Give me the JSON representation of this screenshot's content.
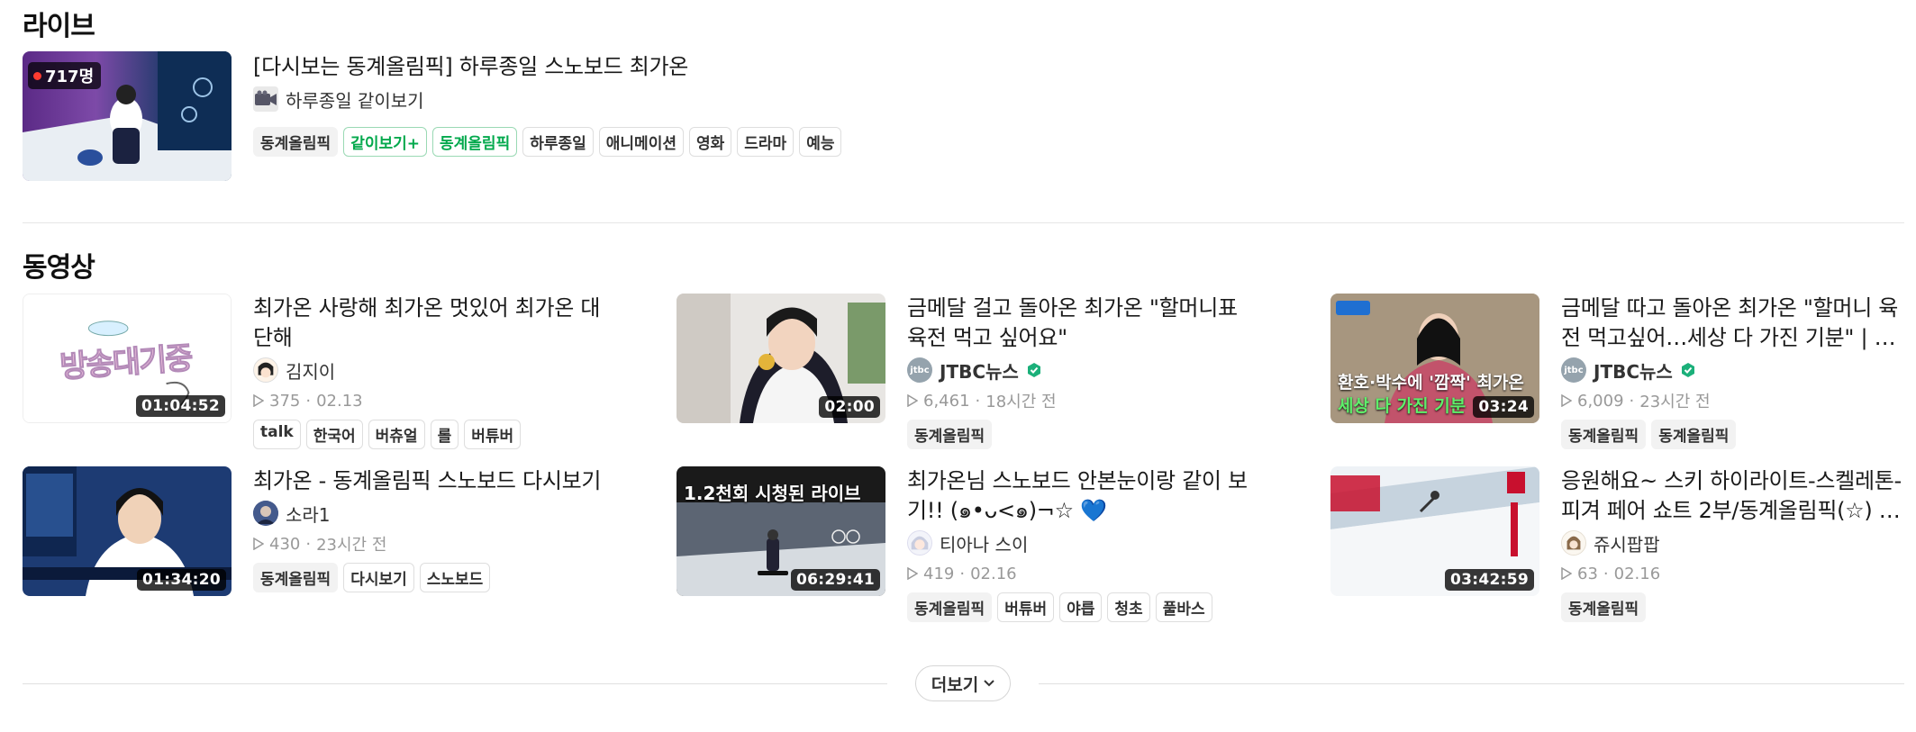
{
  "live": {
    "section_title": "라이브",
    "item": {
      "viewers": "717명",
      "title": "[다시보는 동계올림픽] 하루종일 스노보드 최가온",
      "channel": "하루종일 같이보기",
      "tags": [
        "동계올림픽",
        "같이보기+",
        "동계올림픽",
        "하루종일",
        "애니메이션",
        "영화",
        "드라마",
        "예능"
      ]
    }
  },
  "videos": {
    "section_title": "동영상",
    "items": [
      {
        "title": "최가온 사랑해 최가온 멋있어 최가온 대단해",
        "duration": "01:04:52",
        "thumb_text": "방송대기중",
        "channel": "김지이",
        "views": "375",
        "date": "02.13",
        "tags": [
          "talk",
          "한국어",
          "버츄얼",
          "롤",
          "버튜버"
        ]
      },
      {
        "title": "금메달 걸고 돌아온 최가온 \"할머니표 육전 먹고 싶어요\"",
        "duration": "02:00",
        "channel": "JTBC뉴스",
        "views": "6,461",
        "date": "18시간 전",
        "tags": [
          "동계올림픽"
        ]
      },
      {
        "title": "금메달 따고 돌아온 최가온 \"할머니 육전 먹고싶어…세상 다 가진 기분\" | 지금 이 뉴스",
        "duration": "03:24",
        "thumb_caption": [
          "환호·박수에 '깜짝' 최가온",
          "세상 다 가진 기분"
        ],
        "channel": "JTBC뉴스",
        "views": "6,009",
        "date": "23시간 전",
        "tags": [
          "동계올림픽",
          "동계올림픽"
        ]
      },
      {
        "title": "최가온 - 동계올림픽 스노보드 다시보기",
        "duration": "01:34:20",
        "channel": "소라1",
        "views": "430",
        "date": "23시간 전",
        "tags": [
          "동계올림픽",
          "다시보기",
          "스노보드"
        ]
      },
      {
        "title": "최가온님 스노보드 안본눈이랑 같이 보기!! (๑•ᴗ<๑)¬☆ 💙",
        "duration": "06:29:41",
        "thumb_caption": [
          "1.2천회 시청된 라이브"
        ],
        "channel": "티아나 스이",
        "views": "419",
        "date": "02.16",
        "tags": [
          "동계올림픽",
          "버튜버",
          "야릅",
          "청초",
          "풀바스"
        ]
      },
      {
        "title": "응원해요~ 스키 하이라이트-스켈레톤-피겨 페어 쇼트 2부/동계올림픽(☆) / 동계올림픽",
        "duration": "03:42:59",
        "channel": "쥬시팝팝",
        "views": "63",
        "date": "02.16",
        "tags": [
          "동계올림픽"
        ]
      }
    ]
  },
  "more_button": {
    "label": "더보기"
  },
  "icons": {
    "live_dot": "live-dot-icon",
    "camera": "video-camera-icon",
    "play": "play-outline-icon",
    "verified": "verified-badge-icon",
    "chevron": "chevron-down-icon"
  },
  "colors": {
    "accent_green": "#03a94d",
    "live_red": "#ff3b30",
    "verified_green": "#1bb07a"
  }
}
